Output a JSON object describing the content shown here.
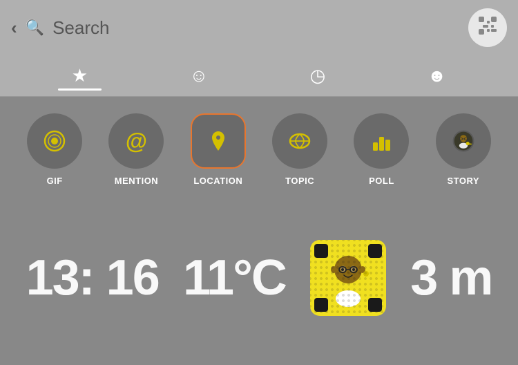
{
  "header": {
    "search_placeholder": "Search",
    "back_label": "‹",
    "snapcode_icon": "⊡"
  },
  "tabs": [
    {
      "id": "favorites",
      "icon": "★",
      "active": true
    },
    {
      "id": "friends",
      "icon": "☺",
      "active": false
    },
    {
      "id": "recent",
      "icon": "◷",
      "active": false
    },
    {
      "id": "subscriptions",
      "icon": "☻",
      "active": false
    }
  ],
  "filters": [
    {
      "id": "gif",
      "label": "GIF",
      "active": false
    },
    {
      "id": "mention",
      "label": "MENTION",
      "active": false
    },
    {
      "id": "location",
      "label": "LOCATION",
      "active": true
    },
    {
      "id": "topic",
      "label": "TOPIC",
      "active": false
    },
    {
      "id": "poll",
      "label": "POLL",
      "active": false
    },
    {
      "id": "story",
      "label": "STORY",
      "active": false
    }
  ],
  "bottom": {
    "time": "13: 16",
    "temp": "11°C",
    "distance": "3 m"
  },
  "accent_color": "#e8762e",
  "icon_color": "#d4c000"
}
